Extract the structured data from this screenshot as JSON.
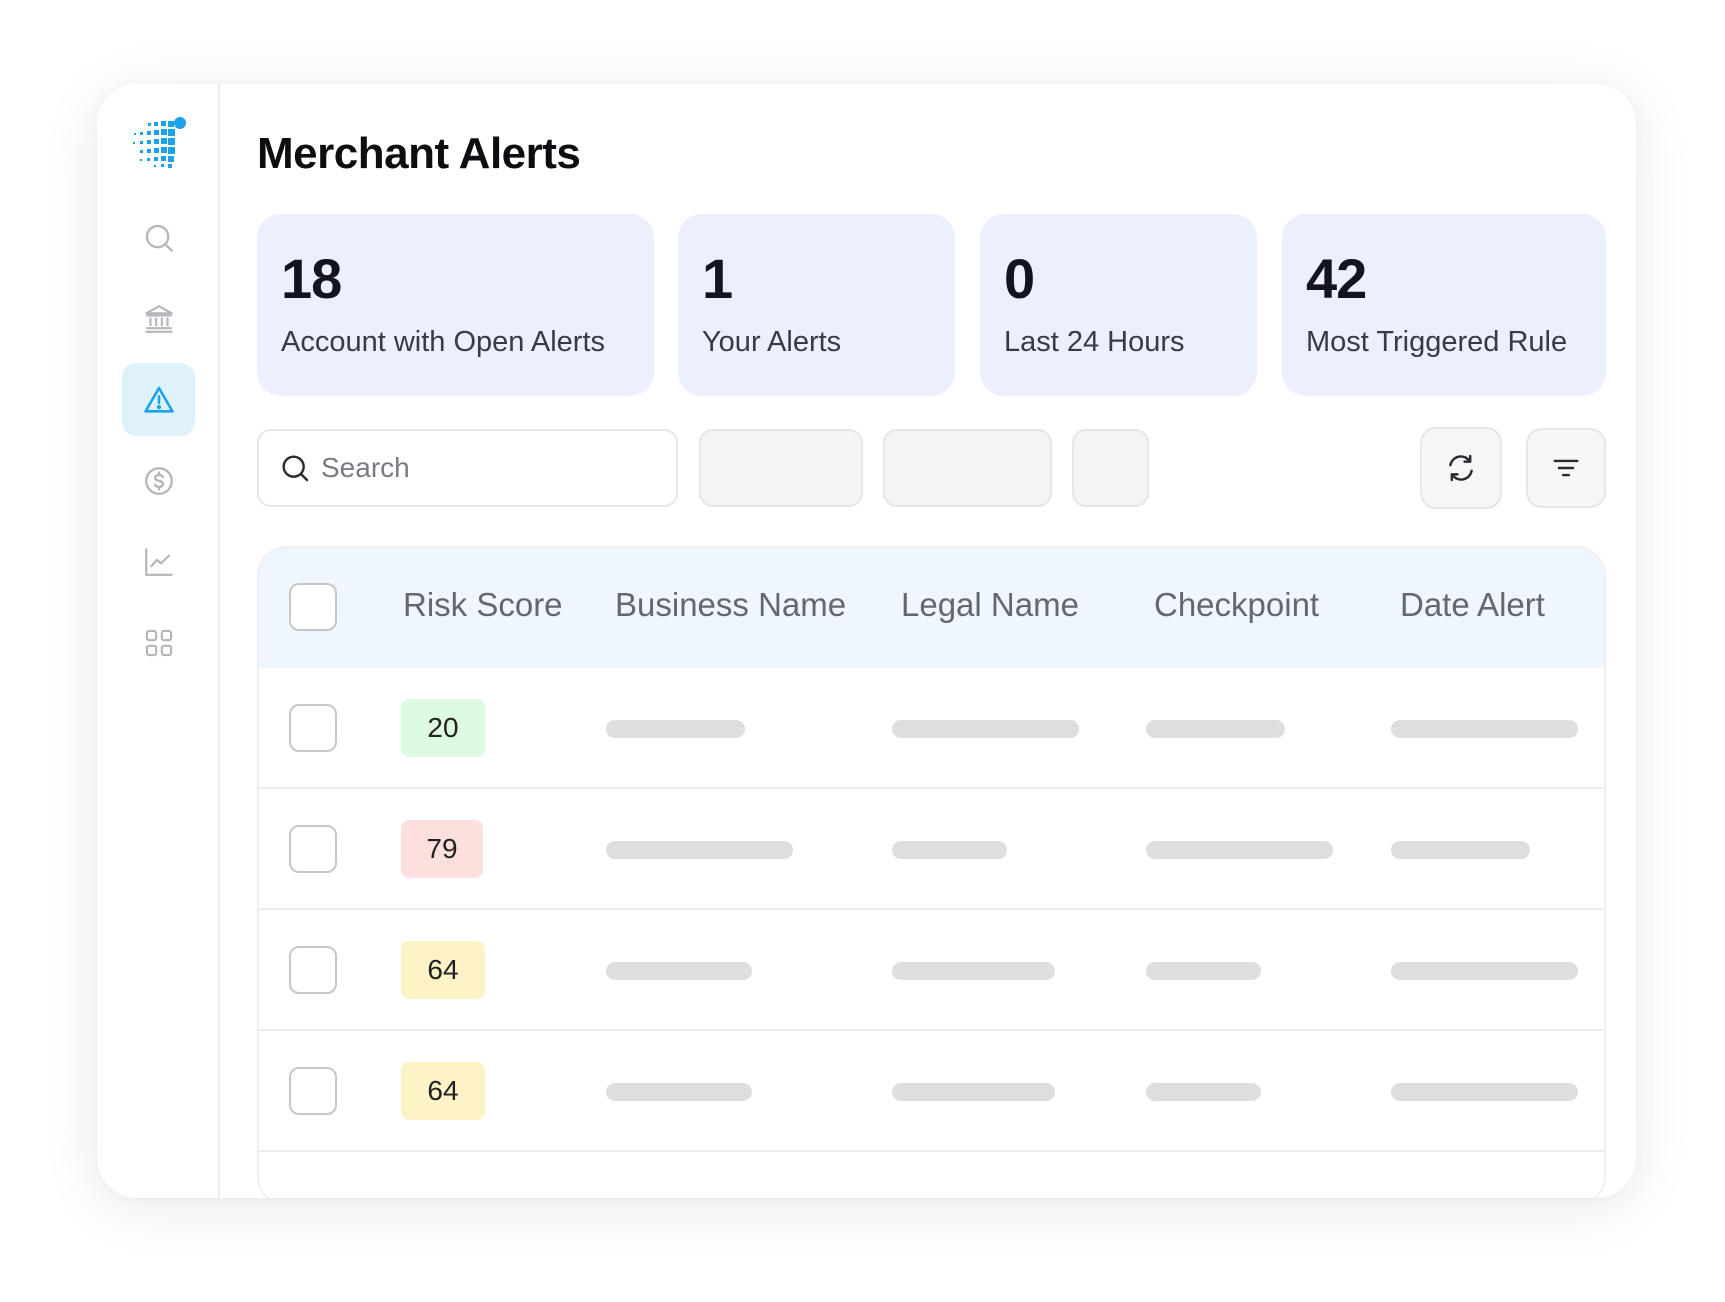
{
  "page": {
    "title": "Merchant Alerts"
  },
  "stats": [
    {
      "value": "18",
      "label": "Account with Open Alerts"
    },
    {
      "value": "1",
      "label": "Your Alerts"
    },
    {
      "value": "0",
      "label": "Last 24 Hours"
    },
    {
      "value": "42",
      "label": "Most Triggered Rule"
    }
  ],
  "sidebar": {
    "items": [
      {
        "icon": "search-icon",
        "active": false
      },
      {
        "icon": "bank-icon",
        "active": false
      },
      {
        "icon": "alert-triangle-icon",
        "active": true
      },
      {
        "icon": "dollar-circle-icon",
        "active": false
      },
      {
        "icon": "chart-line-icon",
        "active": false
      },
      {
        "icon": "grid-icon",
        "active": false
      }
    ]
  },
  "search": {
    "placeholder": "Search"
  },
  "table": {
    "columns": [
      "Risk Score",
      "Business Name",
      "Legal Name",
      "Checkpoint",
      "Date Alert"
    ],
    "rows": [
      {
        "risk_score": "20",
        "level": "low"
      },
      {
        "risk_score": "79",
        "level": "high"
      },
      {
        "risk_score": "64",
        "level": "medium"
      },
      {
        "risk_score": "64",
        "level": "medium"
      }
    ]
  },
  "colors": {
    "accent": "#1aa3e8",
    "card_bg": "#eceffd",
    "header_bg": "#f0f6fe",
    "active_nav_bg": "#dff1fb",
    "risk_low": "#ddfbe0",
    "risk_high": "#fde0de",
    "risk_medium": "#fdf3c7"
  }
}
